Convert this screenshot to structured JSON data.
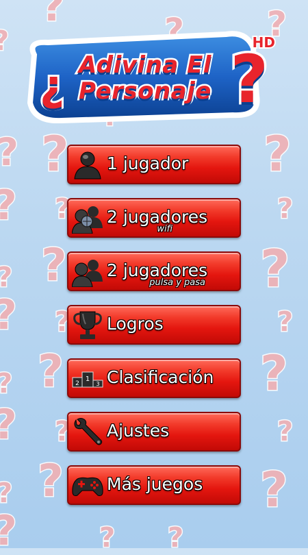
{
  "logo": {
    "line1": "Adivina El",
    "line2": "Personaje",
    "hd_badge": "HD"
  },
  "menu": {
    "items": [
      {
        "label": "1 jugador",
        "sublabel": "",
        "icon": "single-player-icon"
      },
      {
        "label": "2 jugadores",
        "sublabel": "wifi",
        "icon": "players-wifi-icon"
      },
      {
        "label": "2 jugadores",
        "sublabel": "pulsa y pasa",
        "icon": "two-players-icon"
      },
      {
        "label": "Logros",
        "sublabel": "",
        "icon": "trophy-icon"
      },
      {
        "label": "Clasificación",
        "sublabel": "",
        "icon": "podium-icon"
      },
      {
        "label": "Ajustes",
        "sublabel": "",
        "icon": "wrench-icon"
      },
      {
        "label": "Más juegos",
        "sublabel": "",
        "icon": "gamepad-icon"
      }
    ]
  },
  "colors": {
    "button_red": "#e4160f",
    "logo_blue": "#0b3f8f",
    "background": "#bcd8f1"
  }
}
